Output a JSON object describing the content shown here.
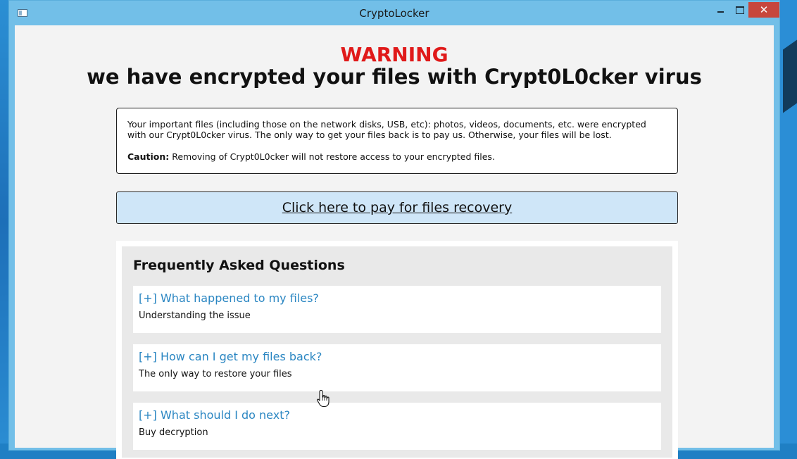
{
  "window": {
    "title": "CryptoLocker",
    "minimize_glyph": "",
    "close_glyph": "✕"
  },
  "header": {
    "warning": "WARNING",
    "headline": "we have encrypted your files with Crypt0L0cker virus"
  },
  "notice": {
    "paragraph1": "Your important files (including those on the network disks, USB, etc): photos, videos, documents, etc. were encrypted with our Crypt0L0cker virus. The only way to get your files back is to pay us. Otherwise, your files will be lost.",
    "caution_label": "Caution:",
    "caution_text": " Removing of Crypt0L0cker will not restore access to your encrypted files."
  },
  "pay_button": {
    "label": "Click here to pay for files recovery"
  },
  "faq": {
    "title": "Frequently Asked Questions",
    "items": [
      {
        "question": "[+] What happened to my files?",
        "answer": "Understanding the issue"
      },
      {
        "question": "[+] How can I get my files back?",
        "answer": "The only way to restore your files"
      },
      {
        "question": "[+] What should I do next?",
        "answer": "Buy decryption"
      }
    ]
  },
  "colors": {
    "warning": "#e01a1a",
    "link": "#2a86c2",
    "titlebar": "#72bfe8",
    "close": "#c7463c",
    "pay_button_bg": "#cfe6f8"
  }
}
